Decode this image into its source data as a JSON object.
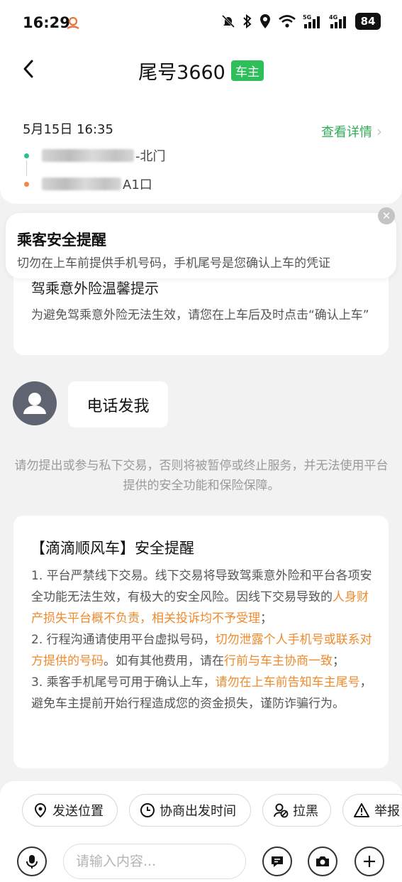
{
  "status_bar": {
    "time": "16:29",
    "battery": "84",
    "signal_5g": "5G",
    "signal_4g": "4G"
  },
  "header": {
    "title": "尾号3660",
    "badge": "车主"
  },
  "trip": {
    "datetime": "5月15日 16:35",
    "detail_link": "查看详情",
    "pickup_suffix": "-北门",
    "dropoff_suffix": "A1口",
    "colors": {
      "pickup_dot": "#2fbf8f",
      "dropoff_dot": "#f0884a",
      "link": "#2fae55"
    }
  },
  "safety_popup": {
    "title": "乘客安全提醒",
    "text": "切勿在上车前提供手机号码，手机尾号是您确认上车的凭证",
    "close_icon": "close-icon"
  },
  "insurance_card": {
    "title": "驾乘意外险温馨提示",
    "text": "为避免驾乘意外险无法生效，请您在上车后及时点击“确认上车”"
  },
  "message": {
    "text": "电话发我",
    "avatar_icon": "user-avatar-icon"
  },
  "notice": "请勿提出或参与私下交易，否则将被暂停或终止服务，并无法使用平台提供的安全功能和保险保障。",
  "reminder": {
    "title": "【滴滴顺风车】安全提醒",
    "p1_a": "1. 平台严禁线下交易。线下交易将导致驾乘意外险和平台各项安全功能无法生效，有极大的安全风险。因线下交易导致的",
    "p1_hl": "人身财产损失平台概不负责，相关投诉均不予受理",
    "p1_b": "；",
    "p2_a": "2. 行程沟通请使用平台虚拟号码，",
    "p2_hl1": "切勿泄露个人手机号或联系对方提供的号码",
    "p2_b": "。如有其他费用，请在",
    "p2_hl2": "行前与车主协商一致",
    "p2_c": "；",
    "p3_a": "3. 乘客手机尾号可用于确认上车，",
    "p3_hl": "请勿在上车前告知车主尾号",
    "p3_b": "，避免车主提前开始行程造成您的资金损失，谨防诈骗行为。",
    "highlight_color": "#f08a2c"
  },
  "quick_actions": [
    {
      "label": "发送位置",
      "icon": "location-pin-icon"
    },
    {
      "label": "协商出发时间",
      "icon": "clock-icon"
    },
    {
      "label": "拉黑",
      "icon": "block-user-icon"
    },
    {
      "label": "举报",
      "icon": "warning-icon"
    }
  ],
  "input": {
    "placeholder": "请输入内容..."
  }
}
